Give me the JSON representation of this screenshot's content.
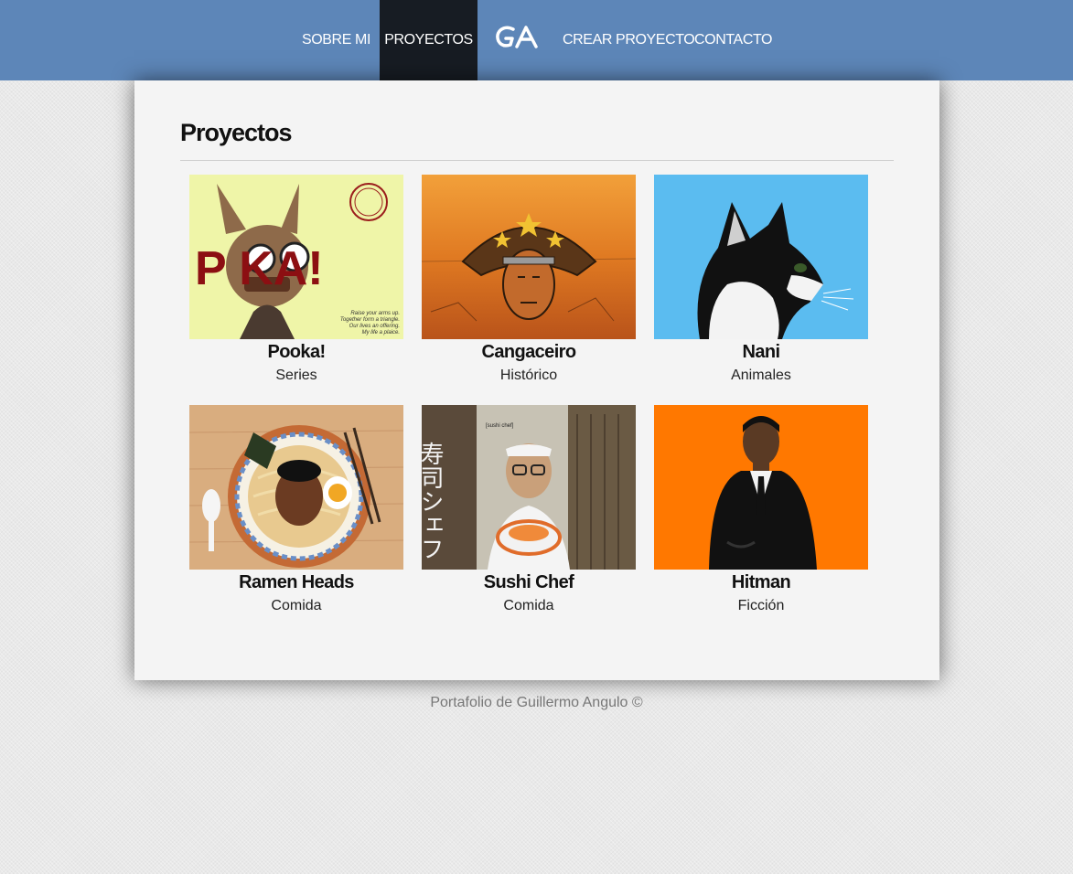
{
  "nav": {
    "items": [
      {
        "label": "SOBRE MI"
      },
      {
        "label": "PROYECTOS",
        "active": true
      },
      {
        "label": "CREAR PROYECTO"
      },
      {
        "label": "CONTACTO"
      }
    ],
    "logo_text": "GA",
    "bar_color": "#5d86b8",
    "active_color": "#171c23"
  },
  "main": {
    "title": "Proyectos",
    "projects": [
      {
        "title": "Pooka!",
        "category": "Series",
        "thumb_icon": "pooka-illustration",
        "thumb_bg": "#eff5a8",
        "thumb_text": "P  KA!",
        "thumb_caption": [
          "Raise your arms up.",
          "Together form a triangle.",
          "Our lives an offering.",
          "My life a plaice."
        ]
      },
      {
        "title": "Cangaceiro",
        "category": "Histórico",
        "thumb_icon": "cangaceiro-illustration",
        "thumb_bg": "#d8731e"
      },
      {
        "title": "Nani",
        "category": "Animales",
        "thumb_icon": "cat-illustration",
        "thumb_bg": "#5bbcf0"
      },
      {
        "title": "Ramen Heads",
        "category": "Comida",
        "thumb_icon": "ramen-illustration",
        "thumb_bg": "#d9ad7f"
      },
      {
        "title": "Sushi Chef",
        "category": "Comida",
        "thumb_icon": "sushi-chef-illustration",
        "thumb_bg": "#c7c2b4",
        "thumb_text": "寿司シェフ",
        "thumb_label": "[sushi chef]"
      },
      {
        "title": "Hitman",
        "category": "Ficción",
        "thumb_icon": "hitman-illustration",
        "thumb_bg": "#ff7800"
      }
    ]
  },
  "footer": {
    "text": "Portafolio de Guillermo Angulo ©"
  }
}
